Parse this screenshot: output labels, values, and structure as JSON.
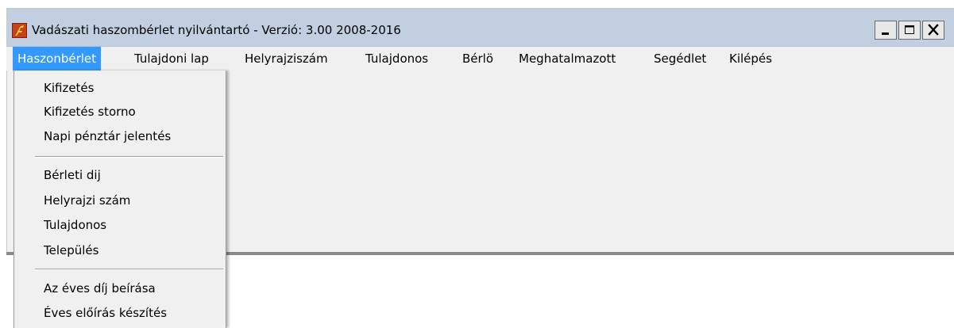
{
  "window": {
    "title": "Vadászati haszombérlet nyilvántartó - Verzió: 3.00 2008-2016",
    "icon": "app-logo-icon",
    "controls": {
      "minimize": "minimize-icon",
      "maximize": "maximize-icon",
      "close": "close-icon"
    }
  },
  "menubar": {
    "items": [
      {
        "label": "Haszonbérlet",
        "active": true
      },
      {
        "label": "Tulajdoni lap"
      },
      {
        "label": "Helyrajziszám"
      },
      {
        "label": "Tulajdonos"
      },
      {
        "label": "Bérlö"
      },
      {
        "label": "Meghatalmazott"
      },
      {
        "label": "Segédlet"
      },
      {
        "label": "Kilépés"
      }
    ]
  },
  "dropdown": {
    "groups": [
      [
        "Kifizetés",
        "Kifizetés storno",
        "Napi pénztár jelentés"
      ],
      [
        "Bérleti dij",
        "Helyrajzi szám",
        "Tulajdonos",
        "Település"
      ],
      [
        "Az éves díj beírása",
        "Éves előírás készítés"
      ]
    ]
  },
  "colors": {
    "titlebar": "#c1cfe0",
    "menu_highlight": "#3399ff",
    "window_bg": "#f0f0f0",
    "app_icon": "#c8401a"
  }
}
